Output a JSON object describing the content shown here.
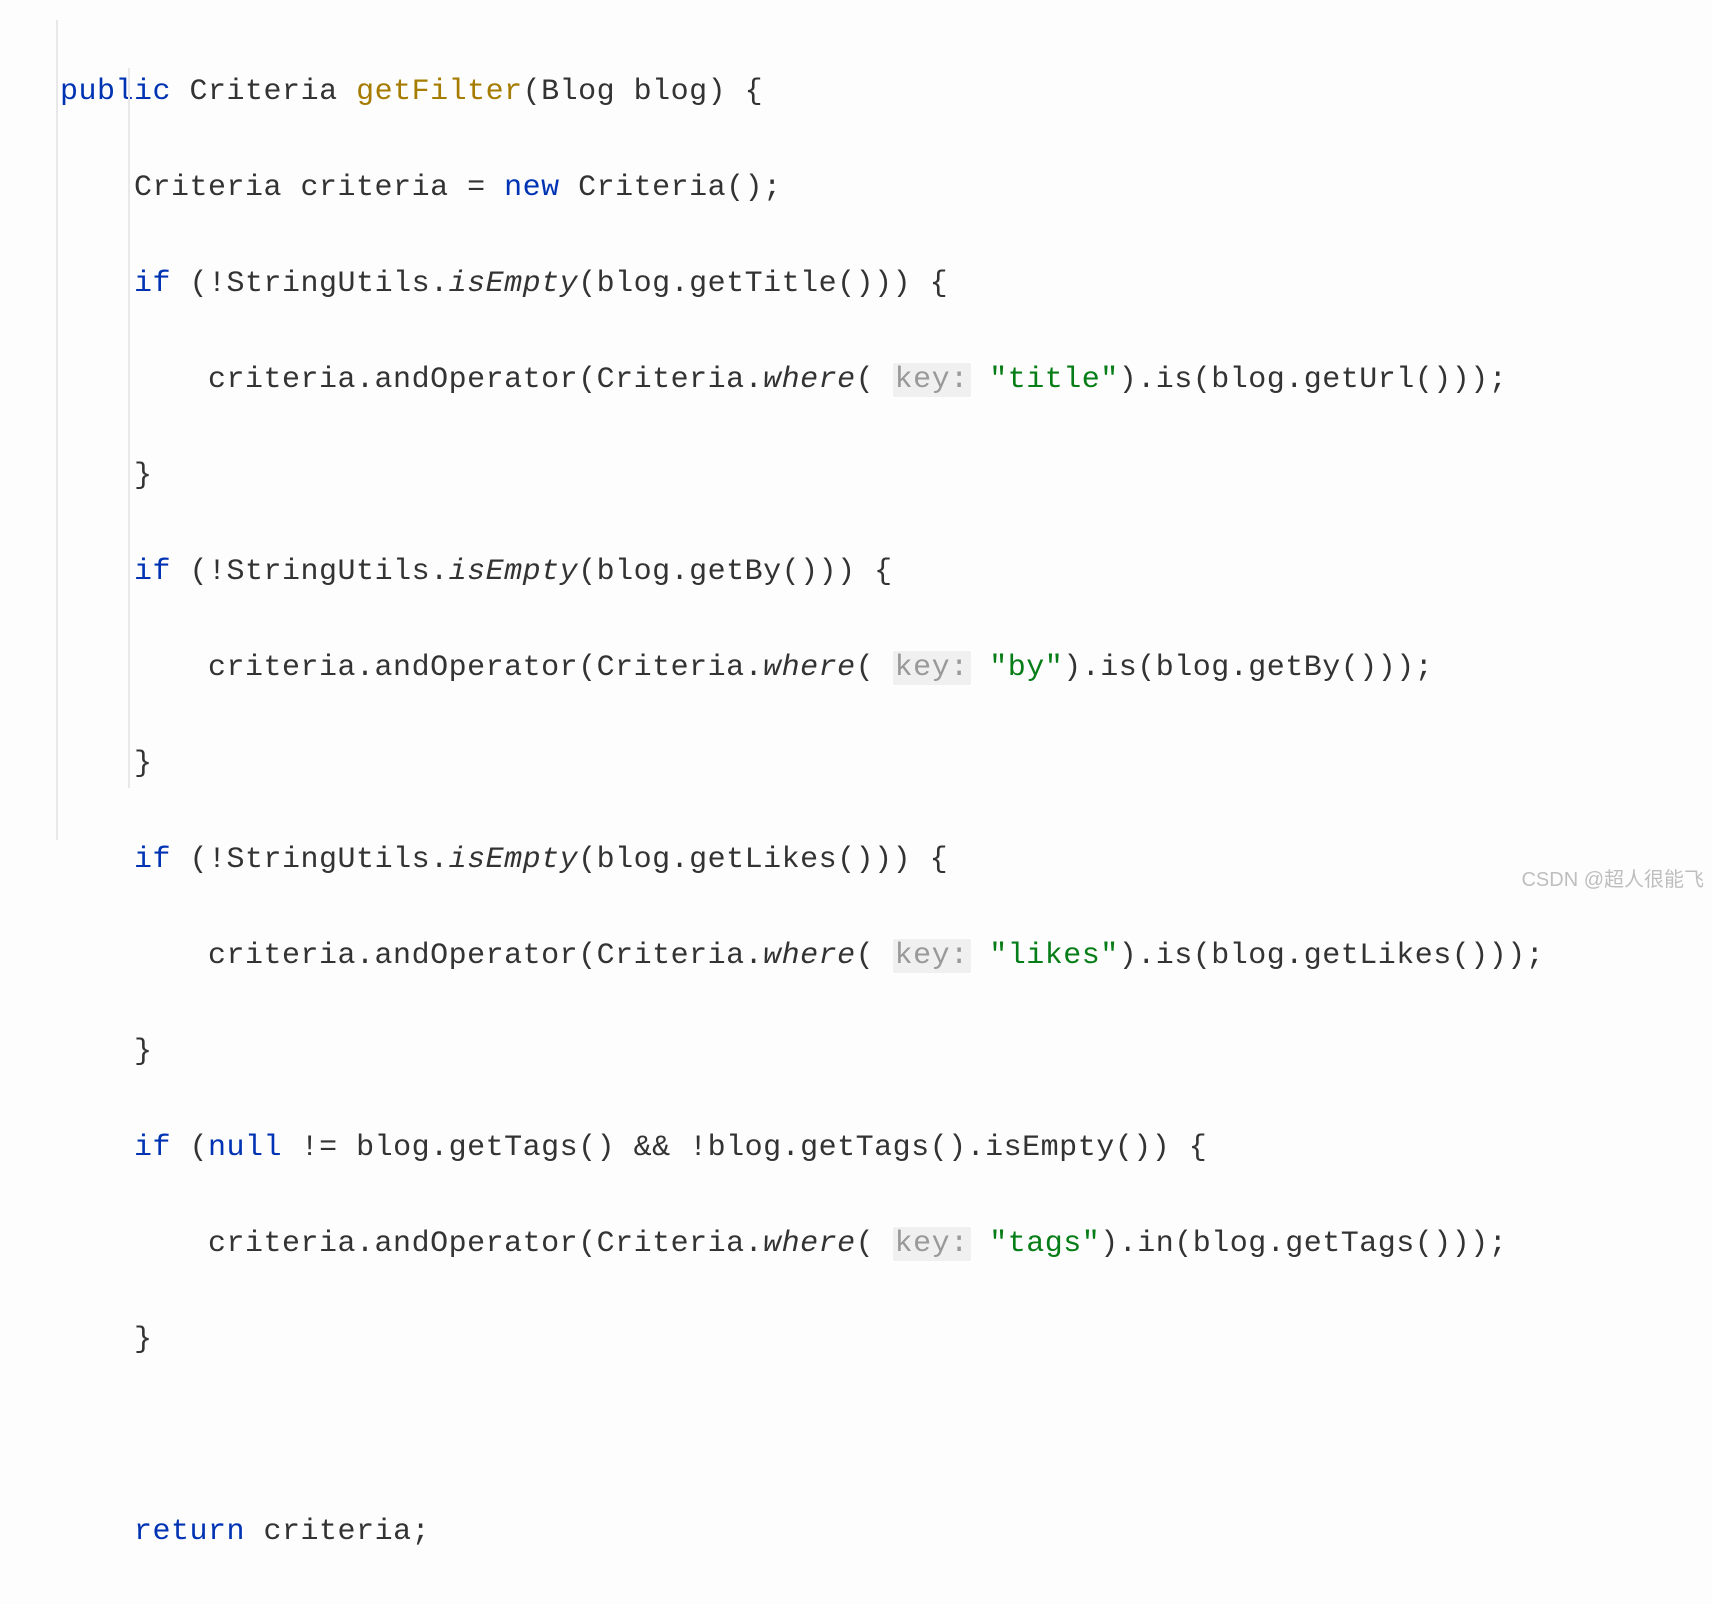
{
  "code": {
    "l1": {
      "kw_public": "public",
      "type1": "Criteria",
      "method": "getFilter",
      "paren_open": "(",
      "type2": "Blog",
      "param": " blog) {"
    },
    "l2": {
      "indent": "    ",
      "type": "Criteria",
      "mid": " criteria = ",
      "kw_new": "new",
      "rest": " Criteria();"
    },
    "l3": {
      "indent": "    ",
      "kw_if": "if",
      "mid1": " (!StringUtils.",
      "static": "isEmpty",
      "rest": "(blog.getTitle())) {"
    },
    "l4": {
      "indent": "        ",
      "mid1": "criteria.andOperator(Criteria.",
      "static": "where",
      "paren": "( ",
      "hint": "key:",
      "space": " ",
      "str": "\"title\"",
      "rest": ").is(blog.getUrl()));"
    },
    "l5": {
      "text": "    }"
    },
    "l6": {
      "indent": "    ",
      "kw_if": "if",
      "mid1": " (!StringUtils.",
      "static": "isEmpty",
      "rest": "(blog.getBy())) {"
    },
    "l7": {
      "indent": "        ",
      "mid1": "criteria.andOperator(Criteria.",
      "static": "where",
      "paren": "( ",
      "hint": "key:",
      "space": " ",
      "str": "\"by\"",
      "rest": ").is(blog.getBy()));"
    },
    "l8": {
      "text": "    }"
    },
    "l9": {
      "indent": "    ",
      "kw_if": "if",
      "mid1": " (!StringUtils.",
      "static": "isEmpty",
      "rest": "(blog.getLikes())) {"
    },
    "l10": {
      "indent": "        ",
      "mid1": "criteria.andOperator(Criteria.",
      "static": "where",
      "paren": "( ",
      "hint": "key:",
      "space": " ",
      "str": "\"likes\"",
      "rest": ").is(blog.getLikes()));"
    },
    "l11": {
      "text": "    }"
    },
    "l12": {
      "indent": "    ",
      "kw_if": "if",
      "mid1": " (",
      "kw_null": "null",
      "rest": " != blog.getTags() && !blog.getTags().isEmpty()) {"
    },
    "l13": {
      "indent": "        ",
      "mid1": "criteria.andOperator(Criteria.",
      "static": "where",
      "paren": "( ",
      "hint": "key:",
      "space": " ",
      "str": "\"tags\"",
      "rest": ").in(blog.getTags()));"
    },
    "l14": {
      "text": "    }"
    },
    "l15": {
      "text": " "
    },
    "l16": {
      "indent": "    ",
      "kw_return": "return",
      "rest": " criteria;"
    }
  },
  "watermark": "CSDN @超人很能飞"
}
